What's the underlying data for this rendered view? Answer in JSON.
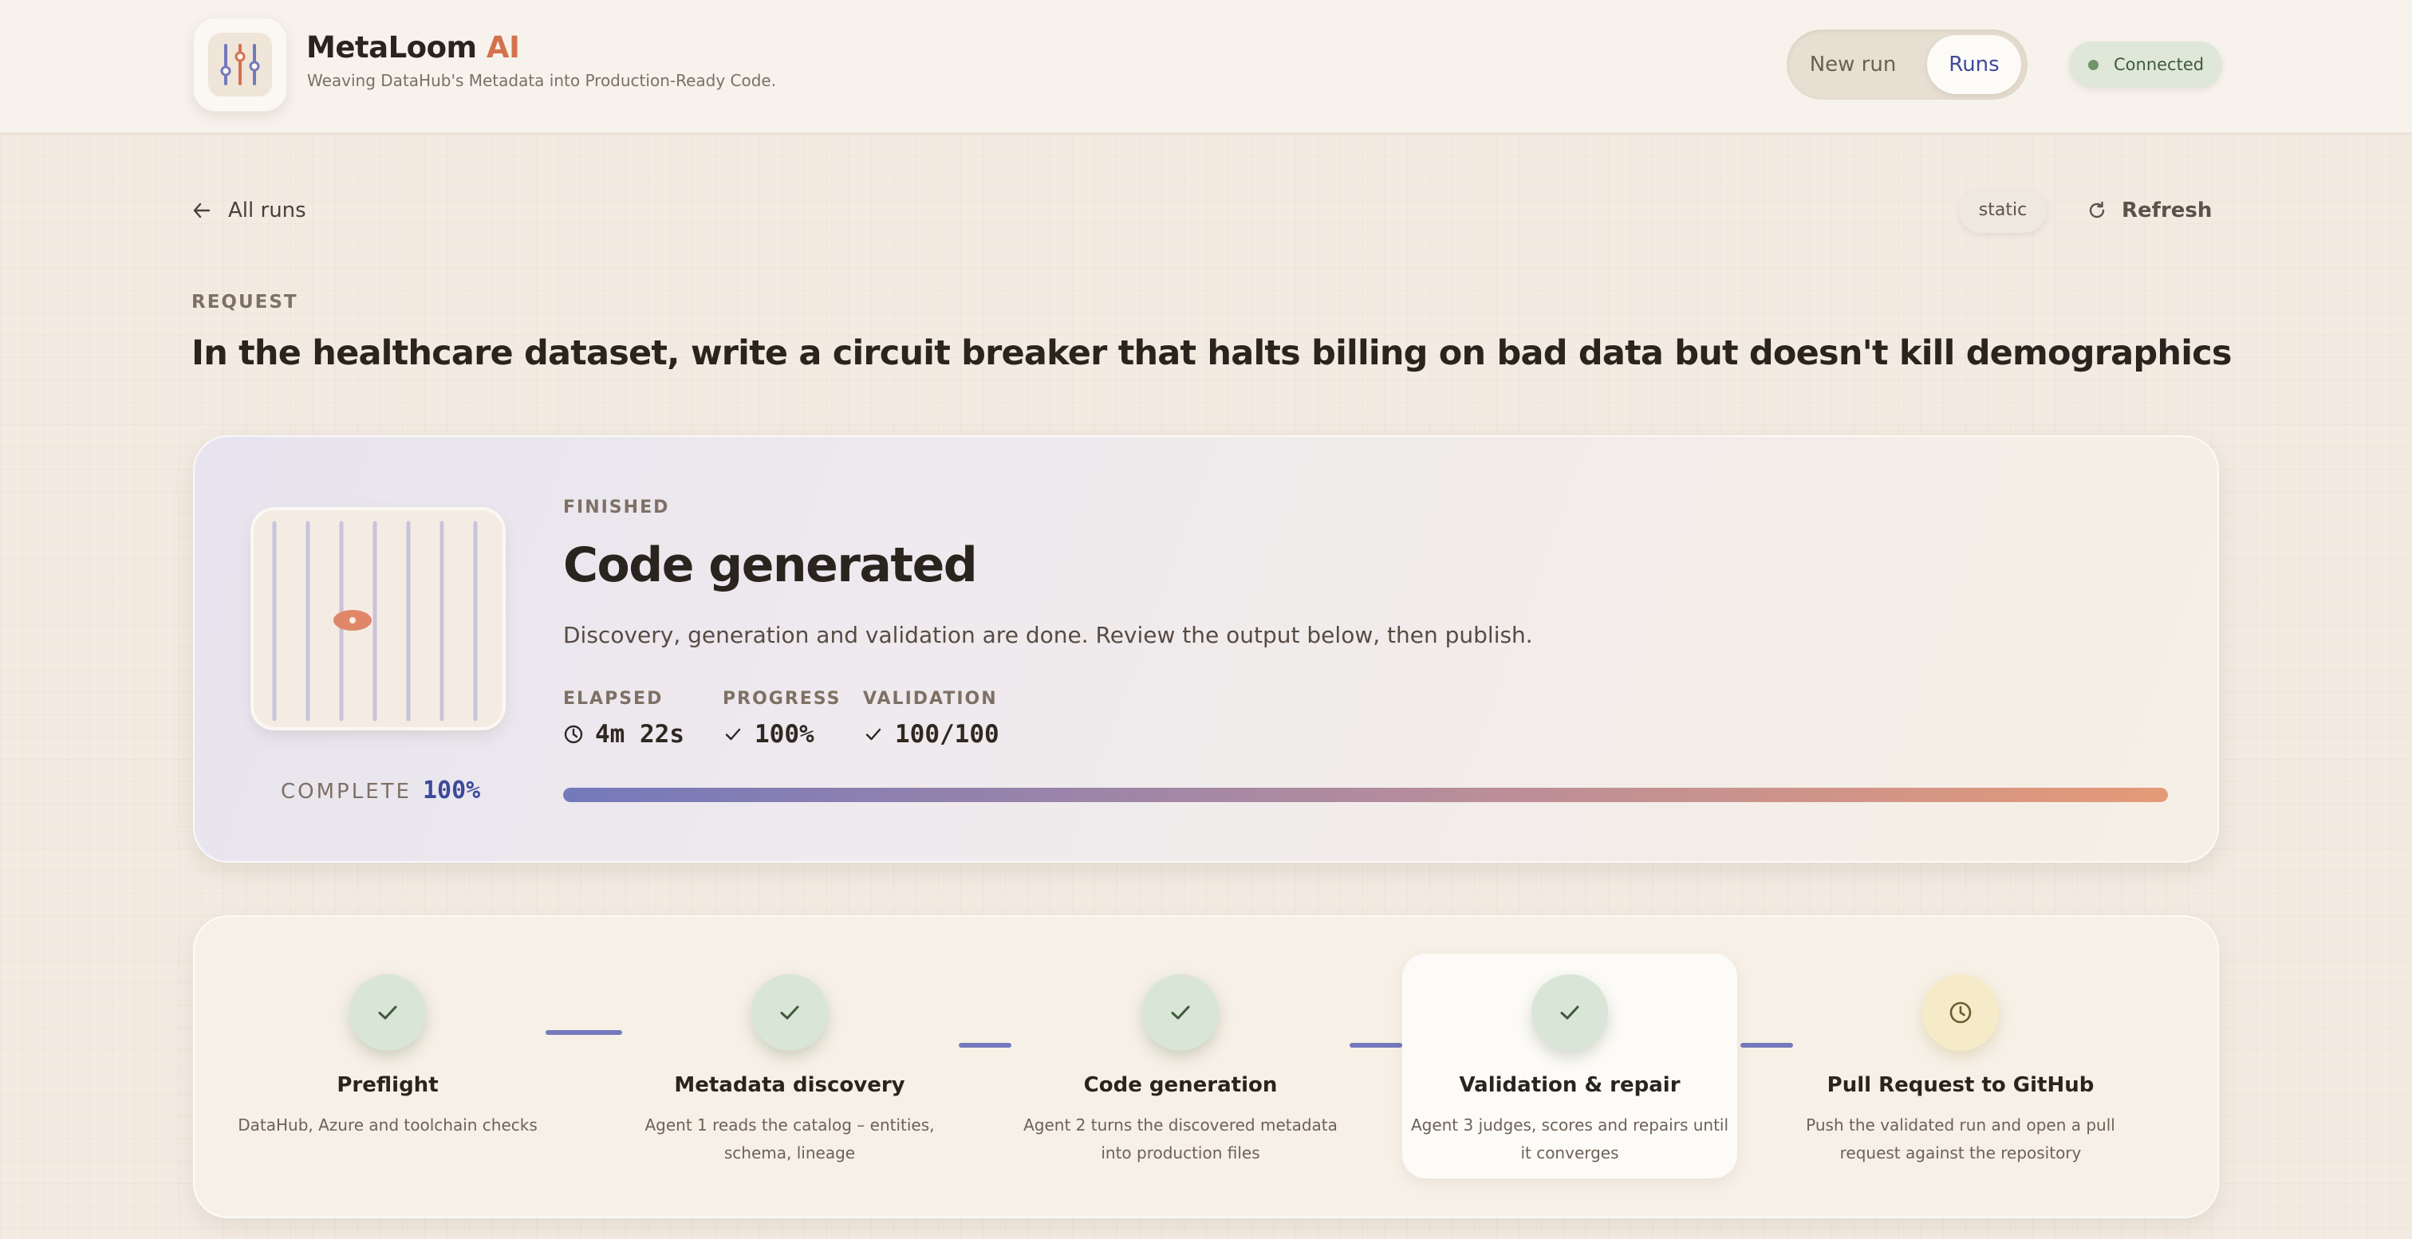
{
  "header": {
    "brand_main": "MetaLoom",
    "brand_ai": " AI",
    "tagline": "Weaving DataHub's Metadata into Production-Ready Code.",
    "nav": {
      "new_run": "New run",
      "runs": "Runs"
    },
    "status": "Connected"
  },
  "subbar": {
    "back": "All runs",
    "mode_badge": "static",
    "refresh": "Refresh"
  },
  "request": {
    "label": "REQUEST",
    "text": "In the healthcare dataset, write a circuit breaker that halts billing on bad data but doesn't kill demographics"
  },
  "status_card": {
    "state": "FINISHED",
    "title": "Code generated",
    "subtitle": "Discovery, generation and validation are done. Review the output below, then publish.",
    "complete_label": "COMPLETE",
    "complete_value": "100%",
    "progress_fraction": 1.0,
    "metrics": [
      {
        "label": "ELAPSED",
        "value": "4m 22s",
        "icon": "clock-icon"
      },
      {
        "label": "PROGRESS",
        "value": "100%",
        "icon": "check-icon"
      },
      {
        "label": "VALIDATION",
        "value": "100/100",
        "icon": "check-icon"
      }
    ]
  },
  "steps": [
    {
      "title": "Preflight",
      "desc": "DataHub, Azure and toolchain checks",
      "status": "done"
    },
    {
      "title": "Metadata discovery",
      "desc": "Agent 1 reads the catalog – entities, schema, lineage",
      "status": "done"
    },
    {
      "title": "Code generation",
      "desc": "Agent 2 turns the discovered metadata into production files",
      "status": "done"
    },
    {
      "title": "Validation & repair",
      "desc": "Agent 3 judges, scores and repairs until it converges",
      "status": "done"
    },
    {
      "title": "Pull Request to GitHub",
      "desc": "Push the validated run and open a pull request against the repository",
      "status": "pending"
    }
  ],
  "colors": {
    "accent": "#3d4a9b",
    "brand_ai": "#d4714d",
    "success_bg": "#d9e5d6",
    "pending_bg": "#f5ebc9",
    "progress_start": "#7479bb",
    "progress_end": "#e49a78"
  }
}
